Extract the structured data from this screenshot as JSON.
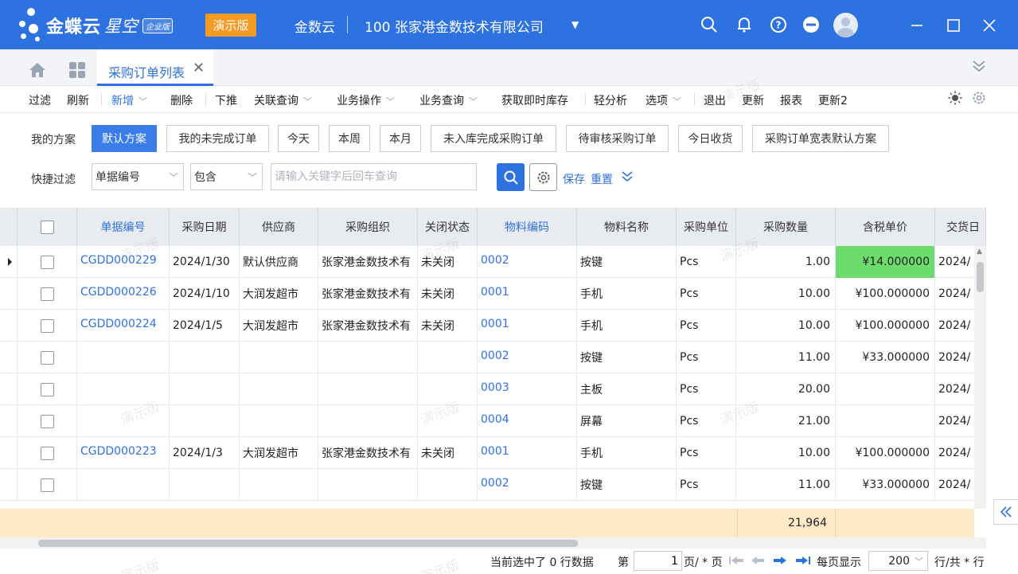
{
  "titlebar": {
    "brand": "金蝶云",
    "product": "星空",
    "edition_badge": "企业版",
    "demo_tag": "演示版",
    "app_name": "金数云",
    "company": "100  张家港金数技术有限公司",
    "brand_color": "#2d72e0"
  },
  "tabs": {
    "active_tab": "采购订单列表",
    "close_glyph": "✕"
  },
  "toolbar": {
    "items": [
      {
        "label": "过滤"
      },
      {
        "label": "刷新"
      },
      {
        "label": "新增"
      },
      {
        "label": "删除"
      },
      {
        "label": "下推"
      },
      {
        "label": "关联查询"
      },
      {
        "label": "业务操作"
      },
      {
        "label": "业务查询"
      },
      {
        "label": "获取即时库存"
      },
      {
        "label": "轻分析"
      },
      {
        "label": "选项"
      },
      {
        "label": "退出"
      },
      {
        "label": "更新"
      },
      {
        "label": "报表"
      },
      {
        "label": "更新2"
      }
    ]
  },
  "scheme": {
    "label": "我的方案",
    "buttons": [
      {
        "label": "默认方案"
      },
      {
        "label": "我的未完成订单"
      },
      {
        "label": "今天"
      },
      {
        "label": "本周"
      },
      {
        "label": "本月"
      },
      {
        "label": "未入库完成采购订单"
      },
      {
        "label": "待审核采购订单"
      },
      {
        "label": "今日收货"
      },
      {
        "label": "采购订单宽表默认方案"
      }
    ]
  },
  "filter": {
    "label": "快捷过滤",
    "field": "单据编号",
    "operator": "包含",
    "placeholder": "请输入关键字后回车查询",
    "save": "保存",
    "reset": "重置"
  },
  "grid": {
    "columns": [
      "单据编号",
      "采购日期",
      "供应商",
      "采购组织",
      "关闭状态",
      "物料编码",
      "物料名称",
      "采购单位",
      "采购数量",
      "含税单价",
      "交货日"
    ],
    "rows": [
      {
        "bill_no": "CGDD000229",
        "date": "2024/1/30",
        "supplier": "默认供应商",
        "org": "张家港金数技术有",
        "close": "未关闭",
        "mat_code": "0002",
        "mat_name": "按键",
        "unit": "Pcs",
        "qty": "1.00",
        "price": "¥14.000000",
        "delivery": "2024/"
      },
      {
        "bill_no": "CGDD000226",
        "date": "2024/1/10",
        "supplier": "大润发超市",
        "org": "张家港金数技术有",
        "close": "未关闭",
        "mat_code": "0001",
        "mat_name": "手机",
        "unit": "Pcs",
        "qty": "10.00",
        "price": "¥100.000000",
        "delivery": "2024/"
      },
      {
        "bill_no": "CGDD000224",
        "date": "2024/1/5",
        "supplier": "大润发超市",
        "org": "张家港金数技术有",
        "close": "未关闭",
        "mat_code": "0001",
        "mat_name": "手机",
        "unit": "Pcs",
        "qty": "10.00",
        "price": "¥100.000000",
        "delivery": "2024/"
      },
      {
        "bill_no": "",
        "date": "",
        "supplier": "",
        "org": "",
        "close": "",
        "mat_code": "0002",
        "mat_name": "按键",
        "unit": "Pcs",
        "qty": "11.00",
        "price": "¥33.000000",
        "delivery": "2024/"
      },
      {
        "bill_no": "",
        "date": "",
        "supplier": "",
        "org": "",
        "close": "",
        "mat_code": "0003",
        "mat_name": "主板",
        "unit": "Pcs",
        "qty": "20.00",
        "price": "",
        "delivery": "2024/"
      },
      {
        "bill_no": "",
        "date": "",
        "supplier": "",
        "org": "",
        "close": "",
        "mat_code": "0004",
        "mat_name": "屏幕",
        "unit": "Pcs",
        "qty": "21.00",
        "price": "",
        "delivery": "2024/"
      },
      {
        "bill_no": "CGDD000223",
        "date": "2024/1/3",
        "supplier": "大润发超市",
        "org": "张家港金数技术有",
        "close": "未关闭",
        "mat_code": "0001",
        "mat_name": "手机",
        "unit": "Pcs",
        "qty": "10.00",
        "price": "¥100.000000",
        "delivery": "2024/"
      },
      {
        "bill_no": "",
        "date": "",
        "supplier": "",
        "org": "",
        "close": "",
        "mat_code": "0002",
        "mat_name": "按键",
        "unit": "Pcs",
        "qty": "11.00",
        "price": "¥33.000000",
        "delivery": "2024/"
      }
    ],
    "highlight_color": "#6ddc6d",
    "summary_qty": "21,964"
  },
  "pager": {
    "selected_text": "当前选中了 0 行数据",
    "page_prefix": "第",
    "page_value": "1",
    "page_suffix": "页/ * 页",
    "per_page_label": "每页显示",
    "per_page_value": "200",
    "rows_suffix": "行/共 * 行"
  },
  "watermark": "演示版"
}
